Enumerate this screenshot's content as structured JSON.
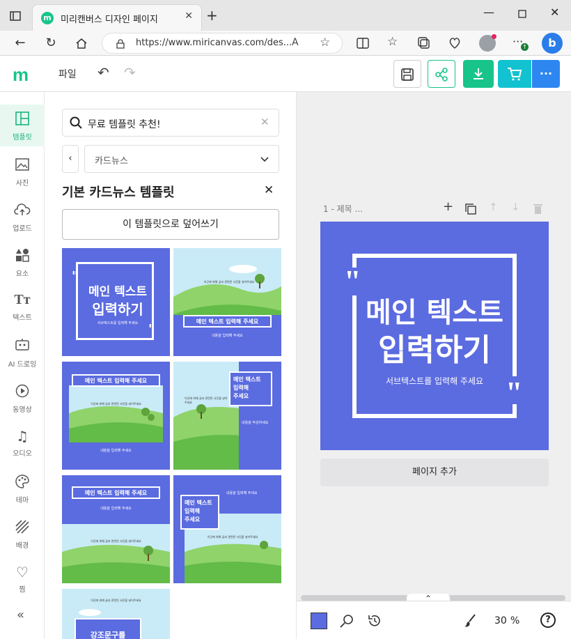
{
  "browser": {
    "tab_title": "미리캔버스 디자인 페이지",
    "url": "https://www.miricanvas.com/des...",
    "new_tab": "+"
  },
  "app": {
    "logo": "m",
    "menu_file": "파일",
    "brand_color": "#18c48a"
  },
  "sidebar": {
    "items": [
      {
        "label": "템플릿",
        "icon": "template-icon"
      },
      {
        "label": "사진",
        "icon": "photo-icon"
      },
      {
        "label": "업로드",
        "icon": "upload-icon"
      },
      {
        "label": "요소",
        "icon": "elements-icon"
      },
      {
        "label": "텍스트",
        "icon": "text-icon"
      },
      {
        "label": "AI 드로잉",
        "icon": "ai-drawing-icon"
      },
      {
        "label": "동영상",
        "icon": "video-icon"
      },
      {
        "label": "오디오",
        "icon": "audio-icon"
      },
      {
        "label": "테마",
        "icon": "theme-icon"
      },
      {
        "label": "배경",
        "icon": "background-icon"
      },
      {
        "label": "찜",
        "icon": "heart-icon"
      }
    ]
  },
  "panel": {
    "search_value": "무료 템플릿 추천!",
    "dropdown_value": "카드뉴스",
    "title": "기본 카드뉴스 템플릿",
    "overwrite_button": "이 템플릿으로 덮어쓰기",
    "thumbs": [
      {
        "main1": "메인 텍스트",
        "main2": "입력하기",
        "sub": "서브텍스트를 입력해 주세요"
      },
      {
        "headline": "메인 텍스트 입력해 주세요",
        "body": "이곳에 위해 글과 관련된 사진을 넣어주세요",
        "footer": "내용을 입력해 주세요"
      },
      {
        "headline": "메인 텍스트 입력해 주세요",
        "body": "이곳에 위해 글과 관련된 사진을 넣어주세요",
        "footer": "내용을 입력해 주세요"
      },
      {
        "l1": "메인 텍스트",
        "l2": "입력해",
        "l3": "주세요",
        "body": "이곳에 위해 글과 관련된 사진을 넣어주세요",
        "footer": "내용을 작성하세요"
      },
      {
        "headline": "메인 텍스트 입력해 주세요",
        "sub": "내용을 입력해 주세요",
        "body": "이곳에 위해 글과 관련된 사진을 넣어주세요"
      },
      {
        "l1": "메인 텍스트",
        "l2": "입력해",
        "l3": "주세요",
        "sub": "내용을 입력해 주세요",
        "body": "이곳에 위해 글과 관련된 사진을 넣어주세요"
      },
      {
        "body": "이곳에 위해 글과 관련된 사진을 넣어주세요",
        "headline": "강조문구를"
      }
    ]
  },
  "canvas": {
    "page_label": "1 - 제목 ...",
    "main1": "메인 텍스트",
    "main2": "입력하기",
    "sub": "서브텍스트를 입력해 주세요",
    "add_page": "페이지 추가",
    "zoom": "30",
    "zoom_unit": "%",
    "page_color": "#5b6be0",
    "help": "?"
  }
}
